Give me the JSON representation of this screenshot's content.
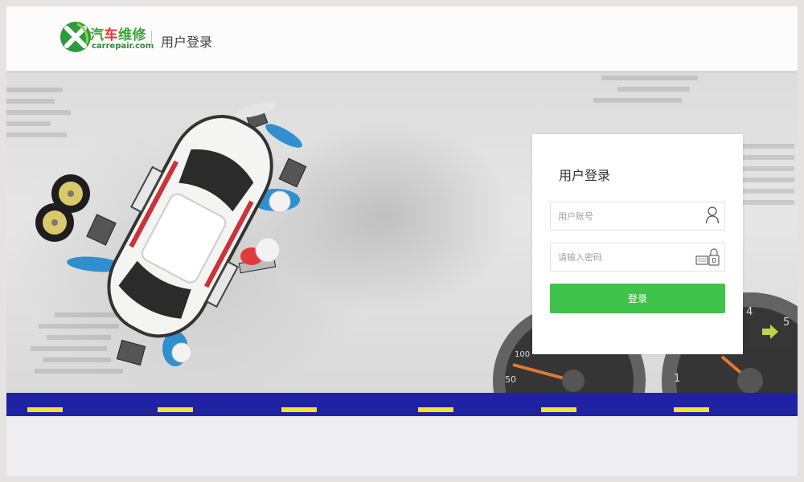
{
  "header": {
    "logo": {
      "cn_prefix": "汽",
      "cn_highlight": "车",
      "cn_suffix": "维修",
      "domain": "carrepair.com"
    },
    "title": "用户登录"
  },
  "login": {
    "title": "用户登录",
    "username_placeholder": "用户账号",
    "password_placeholder": "请输入密码",
    "submit_label": "登录"
  },
  "hero": {
    "gauge_left_labels": [
      "100",
      "50"
    ],
    "gauge_right_labels": [
      "4",
      "5",
      "1"
    ]
  },
  "colors": {
    "brand_green": "#3fc34a",
    "road_blue": "#1f22a2",
    "road_dash_yellow": "#f7e22d",
    "logo_red": "#e03a2e"
  },
  "icons": {
    "username": "user-icon",
    "password": "keyboard-lock-icon"
  }
}
